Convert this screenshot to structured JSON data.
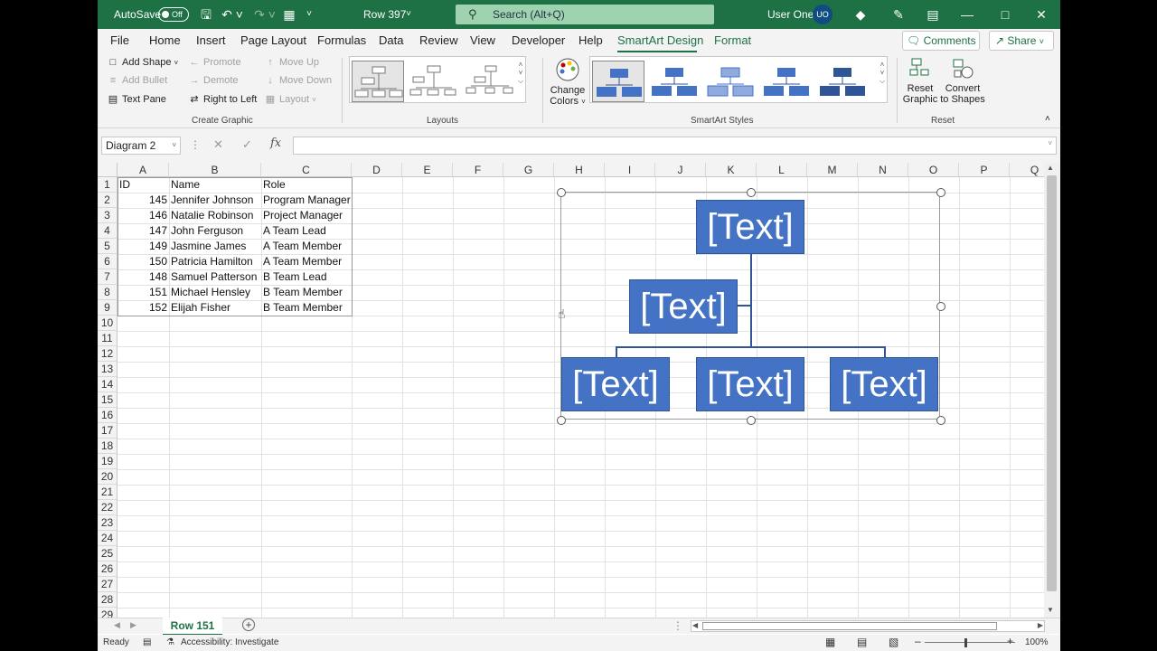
{
  "titlebar": {
    "autosave_label": "AutoSave",
    "autosave_state": "Off",
    "doc_title": "Row 397",
    "search_placeholder": "Search (Alt+Q)",
    "user_name": "User One",
    "user_initials": "UO"
  },
  "menu": {
    "items": [
      "File",
      "Home",
      "Insert",
      "Page Layout",
      "Formulas",
      "Data",
      "Review",
      "View",
      "Developer",
      "Help",
      "SmartArt Design",
      "Format"
    ],
    "active": "SmartArt Design",
    "comments_label": "Comments",
    "share_label": "Share"
  },
  "ribbon": {
    "create_graphic": {
      "label": "Create Graphic",
      "add_shape": "Add Shape",
      "add_bullet": "Add Bullet",
      "text_pane": "Text Pane",
      "promote": "Promote",
      "demote": "Demote",
      "right_to_left": "Right to Left",
      "move_up": "Move Up",
      "move_down": "Move Down",
      "layout": "Layout"
    },
    "layouts": {
      "label": "Layouts"
    },
    "change_colors": {
      "line1": "Change",
      "line2": "Colors"
    },
    "smartart_styles": {
      "label": "SmartArt Styles"
    },
    "reset": {
      "label": "Reset",
      "reset_graphic_1": "Reset",
      "reset_graphic_2": "Graphic",
      "convert_1": "Convert",
      "convert_2": "to Shapes"
    }
  },
  "formula_bar": {
    "name_box": "Diagram 2",
    "fx": "fx",
    "formula": ""
  },
  "columns": [
    "A",
    "B",
    "C",
    "D",
    "E",
    "F",
    "G",
    "H",
    "I",
    "J",
    "K",
    "L",
    "M",
    "N",
    "O",
    "P",
    "Q"
  ],
  "rows": [
    "1",
    "2",
    "3",
    "4",
    "5",
    "6",
    "7",
    "8",
    "9",
    "10",
    "11",
    "12",
    "13",
    "14",
    "15",
    "16",
    "17",
    "18",
    "19",
    "20",
    "21",
    "22",
    "23",
    "24",
    "25",
    "26",
    "27",
    "28",
    "29"
  ],
  "table": {
    "headers": [
      "ID",
      "Name",
      "Role"
    ],
    "rows": [
      [
        "145",
        "Jennifer Johnson",
        "Program Manager"
      ],
      [
        "146",
        "Natalie Robinson",
        "Project Manager"
      ],
      [
        "147",
        "John Ferguson",
        "A Team Lead"
      ],
      [
        "149",
        "Jasmine James",
        "A Team Member"
      ],
      [
        "150",
        "Patricia Hamilton",
        "A Team Member"
      ],
      [
        "148",
        "Samuel Patterson",
        "B Team Lead"
      ],
      [
        "151",
        "Michael Hensley",
        "B Team Member"
      ],
      [
        "152",
        "Elijah Fisher",
        "B Team Member"
      ]
    ]
  },
  "smartart": {
    "box_text": "[Text]",
    "color": "#4472c4"
  },
  "sheets": {
    "active": "Row 151"
  },
  "status": {
    "ready": "Ready",
    "accessibility": "Accessibility: Investigate",
    "zoom": "100%"
  }
}
